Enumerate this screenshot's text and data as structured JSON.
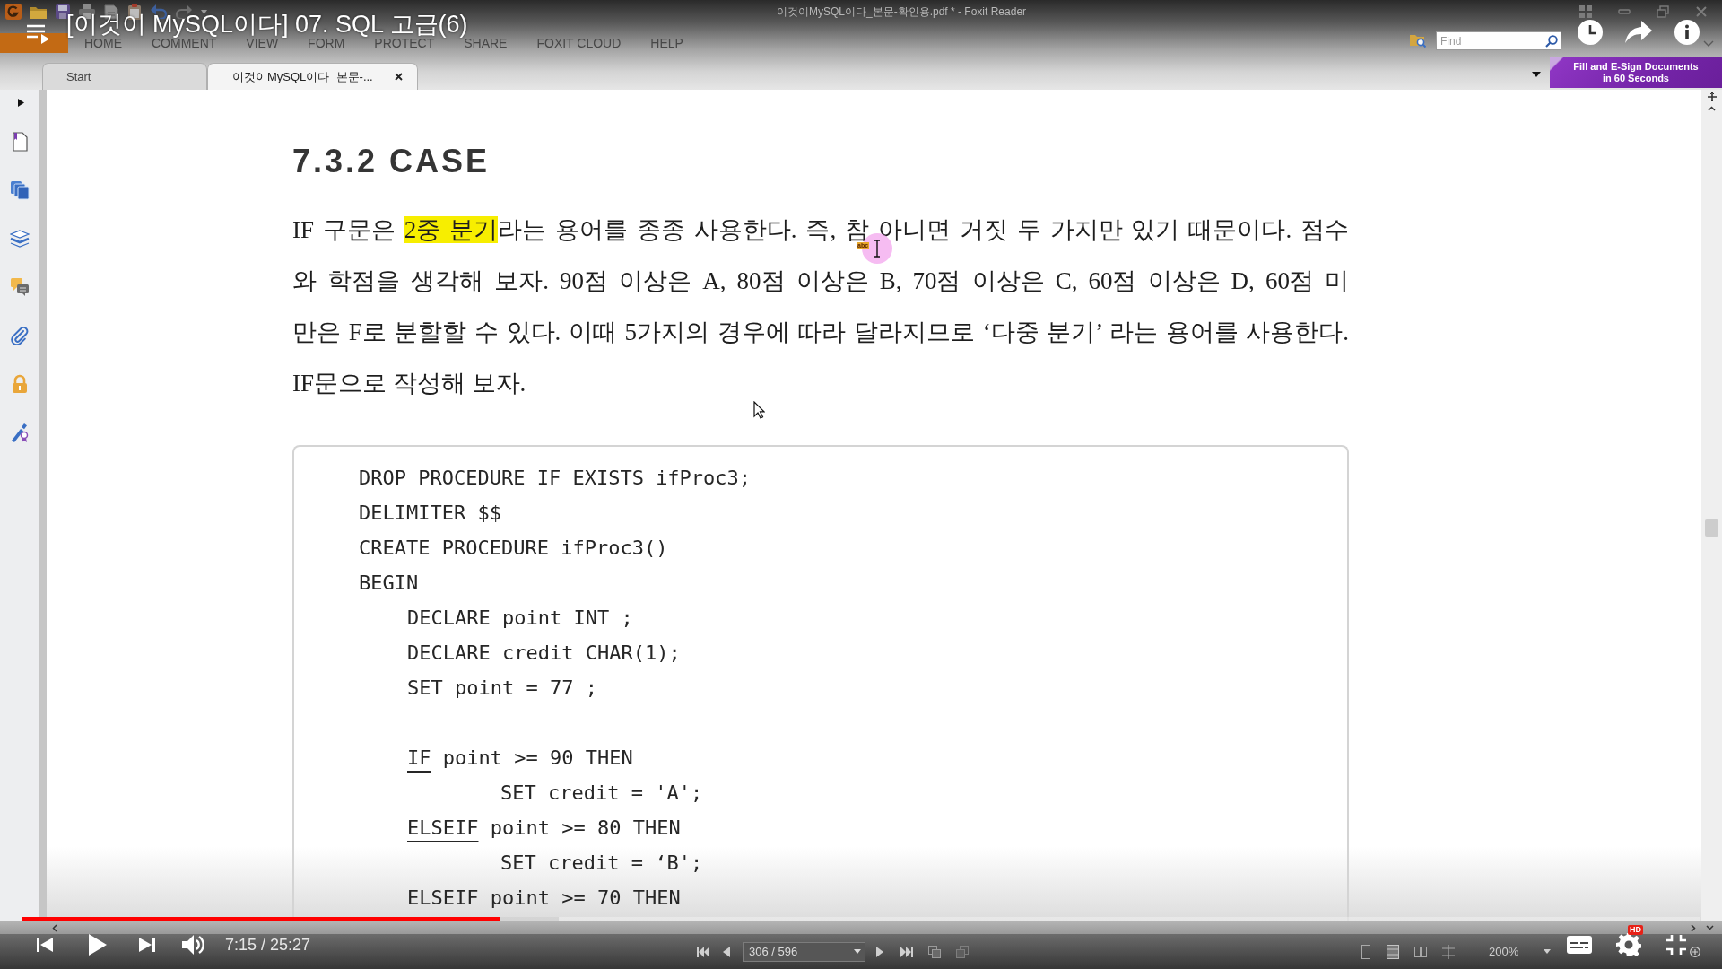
{
  "player": {
    "title": "[이것이 MySQL이다] 07. SQL 고급(6)",
    "progress": {
      "level": 0.285
    },
    "buffered": {
      "level": 0.32
    },
    "playing": false,
    "time": "7:15 / 25:27",
    "quality_badge": "HD"
  },
  "app": {
    "window_title": "이것이MySQL이다_본문-확인용.pdf * - Foxit Reader",
    "menu": [
      "HOME",
      "COMMENT",
      "VIEW",
      "FORM",
      "PROTECT",
      "SHARE",
      "FOXIT CLOUD",
      "HELP"
    ],
    "search": {
      "placeholder": "Find"
    },
    "tabs": [
      {
        "label": "Start",
        "selected": false
      },
      {
        "label": "이것이MySQL이다_본문-...",
        "selected": true
      }
    ],
    "promo": "Fill and E-Sign Documents in 60 Seconds"
  },
  "document": {
    "heading": "7.3.2 CASE",
    "paragraph": [
      {
        "runs": [
          {
            "text": "IF 구문은 ",
            "highlighted": false
          },
          {
            "text": "2중 분기",
            "highlighted": true
          },
          {
            "text": "라는 용어를 종종 사용한다. 즉, 참 아니면 거짓 두 가지만 있기 때문이다. 점수",
            "highlighted": false
          }
        ]
      },
      {
        "runs": [
          {
            "text": "와 학점을 생각해 보자. 90점 이상은 A, 80점 이상은 B, 70점 이상은 C, 60점 이상은 D, 60점 미",
            "highlighted": false
          }
        ]
      },
      {
        "runs": [
          {
            "text": "만은 F로 분할할 수 있다. 이때 5가지의 경우에 따라 달라지므로 ‘다중 분기’ 라는 용어를 사용한다.",
            "highlighted": false
          }
        ]
      },
      {
        "runs": [
          {
            "text": "IF문으로 작성해 보자.",
            "highlighted": false
          }
        ]
      }
    ],
    "cursor_label": "abc",
    "code": [
      {
        "text": "DROP PROCEDURE IF EXISTS ifProc3;"
      },
      {
        "text": "DELIMITER $$"
      },
      {
        "text": "CREATE PROCEDURE ifProc3()"
      },
      {
        "text": "BEGIN",
        "blocks": [
          [
            {
              "text": "DECLARE point INT ;"
            },
            {
              "text": "DECLARE credit CHAR(1);"
            },
            {
              "text": "SET point = 77 ;"
            }
          ],
          [
            {
              "underlined_keyword": "IF",
              "text": " point >= 90 THEN",
              "children": [
                {
                  "text": "SET credit = 'A';"
                }
              ]
            },
            {
              "underlined_keyword": "ELSEIF",
              "text": " point >= 80 THEN",
              "children": [
                {
                  "text": "SET credit = ‘B';"
                }
              ]
            },
            {
              "text": "ELSEIF point >= 70 THEN"
            }
          ]
        ]
      }
    ]
  },
  "status_bar": {
    "page": "306 / 596",
    "zoom": "200%"
  }
}
